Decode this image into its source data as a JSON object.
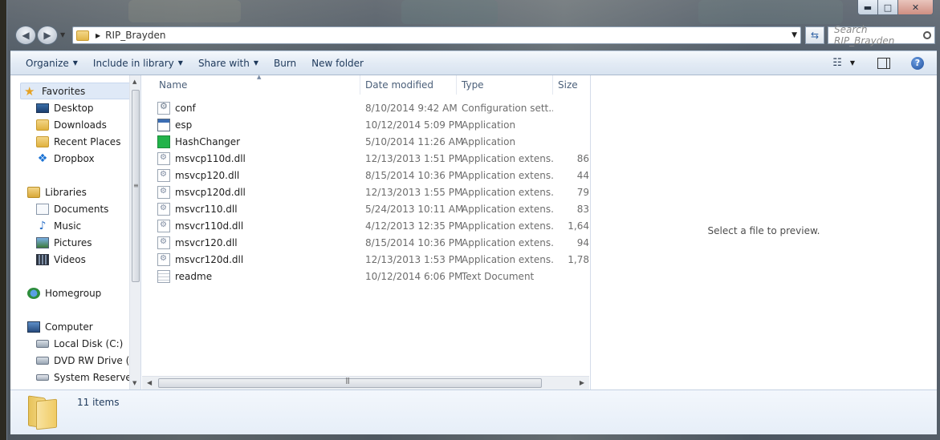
{
  "window": {
    "caption_buttons": {
      "minimize": "▬",
      "maximize": "□",
      "close": "✕"
    }
  },
  "address_bar": {
    "path": "RIP_Brayden",
    "search_placeholder": "Search RIP_Brayden"
  },
  "toolbar": {
    "organize": "Organize",
    "include_in_library": "Include in library",
    "share_with": "Share with",
    "burn": "Burn",
    "new_folder": "New folder"
  },
  "nav_pane": {
    "favorites": {
      "label": "Favorites",
      "items": [
        "Desktop",
        "Downloads",
        "Recent Places",
        "Dropbox"
      ]
    },
    "libraries": {
      "label": "Libraries",
      "items": [
        "Documents",
        "Music",
        "Pictures",
        "Videos"
      ]
    },
    "homegroup": "Homegroup",
    "computer": {
      "label": "Computer",
      "items": [
        "Local Disk (C:)",
        "DVD RW Drive (D",
        "System Reserved"
      ]
    }
  },
  "file_list": {
    "columns": {
      "name": "Name",
      "date": "Date modified",
      "type": "Type",
      "size": "Size"
    },
    "rows": [
      {
        "name": "conf",
        "date": "8/10/2014 9:42 AM",
        "type": "Configuration sett...",
        "size": "",
        "icon": "settings-file-icon"
      },
      {
        "name": "esp",
        "date": "10/12/2014 5:09 PM",
        "type": "Application",
        "size": "",
        "icon": "application-icon"
      },
      {
        "name": "HashChanger",
        "date": "5/10/2014 11:26 AM",
        "type": "Application",
        "size": "",
        "icon": "green-app-icon"
      },
      {
        "name": "msvcp110d.dll",
        "date": "12/13/2013 1:51 PM",
        "type": "Application extens...",
        "size": "86",
        "icon": "dll-icon"
      },
      {
        "name": "msvcp120.dll",
        "date": "8/15/2014 10:36 PM",
        "type": "Application extens...",
        "size": "44",
        "icon": "dll-icon"
      },
      {
        "name": "msvcp120d.dll",
        "date": "12/13/2013 1:55 PM",
        "type": "Application extens...",
        "size": "79",
        "icon": "dll-icon"
      },
      {
        "name": "msvcr110.dll",
        "date": "5/24/2013 10:11 AM",
        "type": "Application extens...",
        "size": "83",
        "icon": "dll-icon"
      },
      {
        "name": "msvcr110d.dll",
        "date": "4/12/2013 12:35 PM",
        "type": "Application extens...",
        "size": "1,64",
        "icon": "dll-icon"
      },
      {
        "name": "msvcr120.dll",
        "date": "8/15/2014 10:36 PM",
        "type": "Application extens...",
        "size": "94",
        "icon": "dll-icon"
      },
      {
        "name": "msvcr120d.dll",
        "date": "12/13/2013 1:53 PM",
        "type": "Application extens...",
        "size": "1,78",
        "icon": "dll-icon"
      },
      {
        "name": "readme",
        "date": "10/12/2014 6:06 PM",
        "type": "Text Document",
        "size": "",
        "icon": "text-file-icon"
      }
    ]
  },
  "preview_pane": {
    "message": "Select a file to preview."
  },
  "details_pane": {
    "item_count": "11 items"
  },
  "colors": {
    "toolbar_text": "#1e395b",
    "selection": "#dfe9f7",
    "hashchanger_icon": "#22b34a"
  }
}
